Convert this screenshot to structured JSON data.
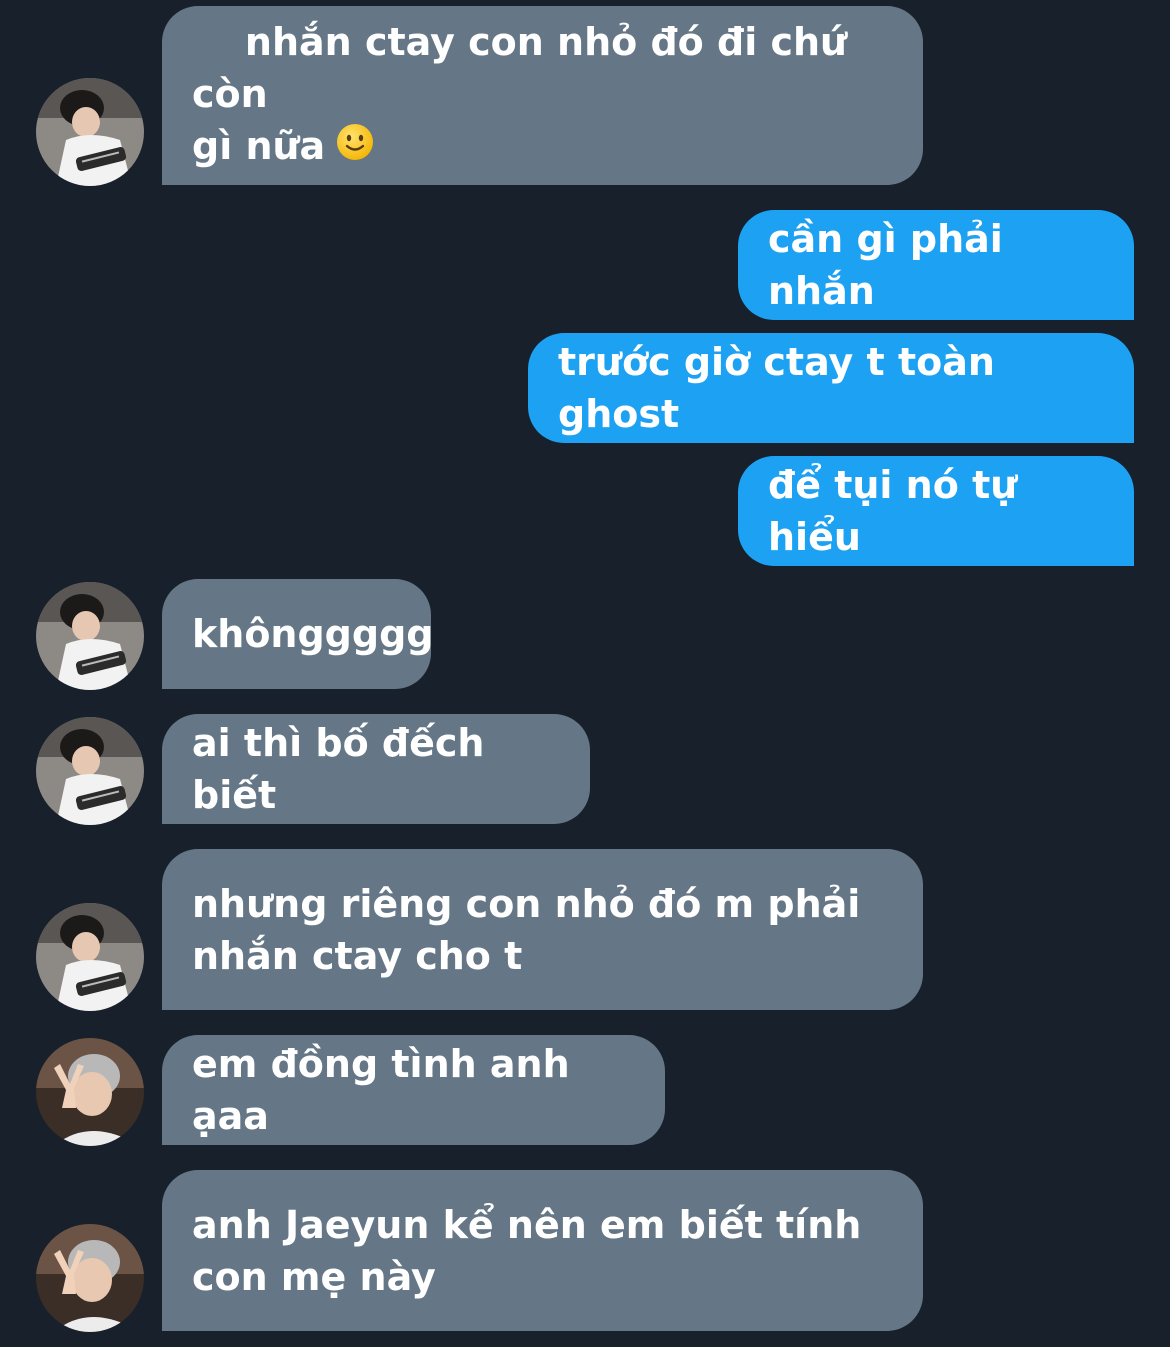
{
  "messages": [
    {
      "sender": "them",
      "avatar": "avatar-guitar-boy",
      "text": "nhắn ctay con nhỏ đó đi chứ còn\ngì nữa",
      "emoji": "slightly-smiling-face-icon"
    },
    {
      "sender": "me",
      "text": "cần gì phải nhắn"
    },
    {
      "sender": "me",
      "text": "trước giờ ctay t toàn ghost"
    },
    {
      "sender": "me",
      "text": "để tụi nó tự hiểu"
    },
    {
      "sender": "them",
      "avatar": "avatar-guitar-boy",
      "text": "khônggggg"
    },
    {
      "sender": "them",
      "avatar": "avatar-guitar-boy",
      "text": "ai thì bố đếch biết"
    },
    {
      "sender": "them",
      "avatar": "avatar-guitar-boy",
      "text": "nhưng riêng con nhỏ đó m phải\nnhắn ctay cho t"
    },
    {
      "sender": "them",
      "avatar": "avatar-peace-sign-boy",
      "text": "em đồng tình anh ạaa"
    },
    {
      "sender": "them",
      "avatar": "avatar-peace-sign-boy",
      "text": "anh Jaeyun kể nên em biết tính\ncon mẹ này"
    }
  ],
  "colors": {
    "background": "#17202b",
    "incoming_bubble": "#657786",
    "outgoing_bubble": "#1da1f2",
    "text": "#ffffff"
  }
}
